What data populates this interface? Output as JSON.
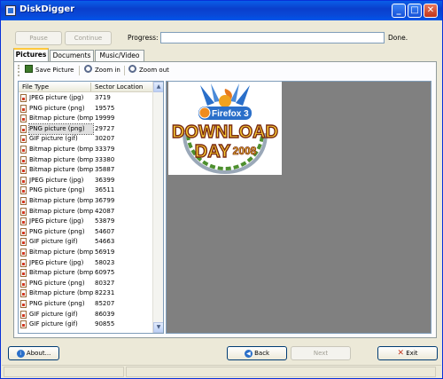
{
  "window": {
    "title": "DiskDigger"
  },
  "titlebar_buttons": {
    "minimize": "_",
    "maximize": "□",
    "close": "✕"
  },
  "controls": {
    "pause_label": "Pause",
    "continue_label": "Continue",
    "progress_label": "Progress:",
    "progress_value": 0,
    "done_label": "Done."
  },
  "tabs": [
    {
      "label": "Pictures",
      "active": true
    },
    {
      "label": "Documents",
      "active": false
    },
    {
      "label": "Music/Video",
      "active": false
    }
  ],
  "toolbar": {
    "save_label": "Save Picture",
    "zoom_in_label": "Zoom in",
    "zoom_out_label": "Zoom out"
  },
  "file_list": {
    "columns": [
      "File Type",
      "Sector Location"
    ],
    "rows": [
      {
        "type": "JPEG picture (jpg)",
        "sector": "3719"
      },
      {
        "type": "PNG picture (png)",
        "sector": "19575"
      },
      {
        "type": "Bitmap picture (bmp)",
        "sector": "19999"
      },
      {
        "type": "PNG picture (png)",
        "sector": "29727",
        "selected": true
      },
      {
        "type": "GIF picture (gif)",
        "sector": "30207"
      },
      {
        "type": "Bitmap picture (bmp)",
        "sector": "33379"
      },
      {
        "type": "Bitmap picture (bmp)",
        "sector": "33380"
      },
      {
        "type": "Bitmap picture (bmp)",
        "sector": "35887"
      },
      {
        "type": "JPEG picture (jpg)",
        "sector": "36399"
      },
      {
        "type": "PNG picture (png)",
        "sector": "36511"
      },
      {
        "type": "Bitmap picture (bmp)",
        "sector": "36799"
      },
      {
        "type": "Bitmap picture (bmp)",
        "sector": "42087"
      },
      {
        "type": "JPEG picture (jpg)",
        "sector": "53879"
      },
      {
        "type": "PNG picture (png)",
        "sector": "54607"
      },
      {
        "type": "GIF picture (gif)",
        "sector": "54663"
      },
      {
        "type": "Bitmap picture (bmp)",
        "sector": "56919"
      },
      {
        "type": "JPEG picture (jpg)",
        "sector": "58023"
      },
      {
        "type": "Bitmap picture (bmp)",
        "sector": "60975"
      },
      {
        "type": "PNG picture (png)",
        "sector": "80327"
      },
      {
        "type": "Bitmap picture (bmp)",
        "sector": "82231"
      },
      {
        "type": "PNG picture (png)",
        "sector": "85207"
      },
      {
        "type": "GIF picture (gif)",
        "sector": "86039"
      },
      {
        "type": "GIF picture (gif)",
        "sector": "90855"
      }
    ]
  },
  "preview_image": {
    "line1": "Firefox 3",
    "line2": "DOWNLOAD",
    "line3": "DAY",
    "year": "2008"
  },
  "footer": {
    "about_label": "About...",
    "back_label": "Back",
    "next_label": "Next",
    "exit_label": "Exit"
  },
  "colors": {
    "titlebar": "#0a47d6",
    "preview_bg": "#808080",
    "accent": "#ffc83c"
  }
}
